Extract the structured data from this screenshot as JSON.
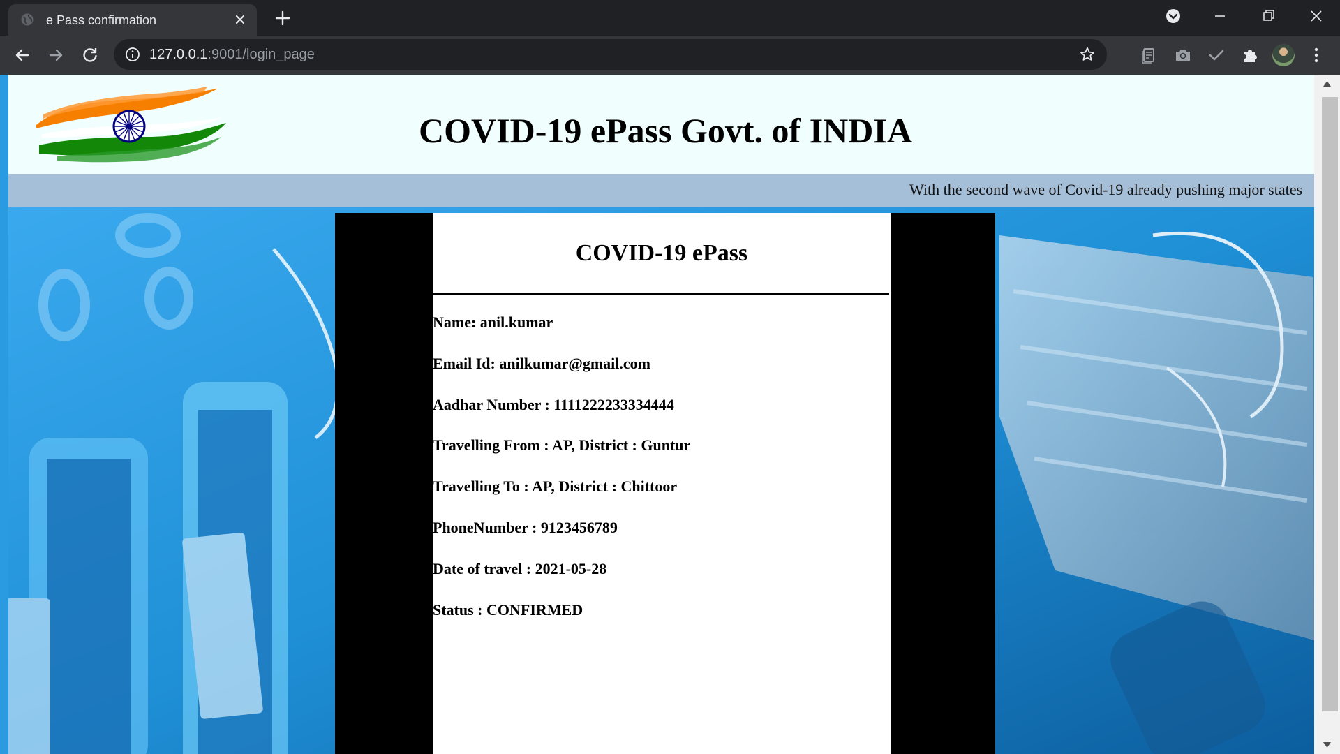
{
  "browser": {
    "tab_title": "e Pass confirmation",
    "url_host": "127.0.0.1",
    "url_path": ":9001/login_page"
  },
  "header": {
    "title": "COVID-19 ePass Govt. of INDIA"
  },
  "marquee": {
    "text": "With the second wave of Covid-19 already pushing major states"
  },
  "card": {
    "title": "COVID-19 ePass",
    "fields": [
      "Name: anil.kumar",
      "Email Id: anilkumar@gmail.com",
      "Aadhar Number : 1111222233334444",
      "Travelling From : AP, District : Guntur",
      "Travelling To : AP, District : Chittoor",
      "PhoneNumber : 9123456789",
      "Date of travel : 2021-05-28",
      "Status : CONFIRMED"
    ]
  },
  "colors": {
    "accent_saffron": "#f77f00",
    "accent_green": "#138808",
    "chakra_navy": "#000080",
    "header_bg": "#f0fefe",
    "marquee_bg": "#a6bfd9"
  },
  "icons": [
    "globe-icon",
    "close-icon",
    "plus-icon",
    "tab-search-icon",
    "minimize-icon",
    "maximize-icon",
    "window-close-icon",
    "back-arrow-icon",
    "forward-arrow-icon",
    "reload-icon",
    "info-icon",
    "star-icon",
    "reading-list-icon",
    "camera-icon",
    "checkmark-icon",
    "puzzle-icon",
    "kebab-menu-icon",
    "india-flag-logo"
  ]
}
